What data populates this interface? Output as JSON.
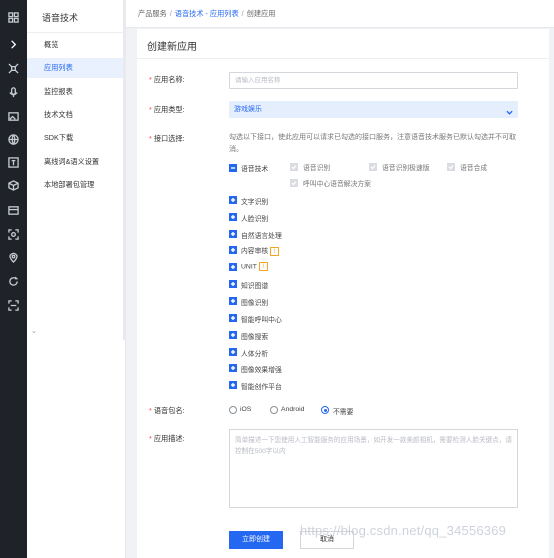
{
  "rail": {
    "icons": [
      "grid-icon",
      "chevron-right-icon",
      "drone-icon",
      "microphone-icon",
      "image-icon",
      "globe-icon",
      "text-icon",
      "cube-icon",
      "screen-icon",
      "face-scan-icon",
      "map-pin-icon",
      "refresh-icon",
      "scan-icon"
    ]
  },
  "menu": {
    "title": "语音技术",
    "items": [
      "概览",
      "应用列表",
      "监控报表",
      "技术文档",
      "SDK下载",
      "离线词&语义设置",
      "本地部署包管理"
    ],
    "active_index": 1,
    "collapse_icon": "chevron-down-icon"
  },
  "breadcrumb": {
    "root": "产品服务",
    "separator": "/",
    "link": "语音技术 - 应用列表",
    "current": "创建应用"
  },
  "page": {
    "title": "创建新应用"
  },
  "form": {
    "required_mark": "*",
    "name": {
      "label": "应用名称:",
      "placeholder": "请输入应用名称",
      "value": ""
    },
    "type": {
      "label": "应用类型:",
      "value": "游戏娱乐"
    },
    "api": {
      "label": "接口选择:",
      "description": "勾选以下接口，使此应用可以请求已勾选的接口服务，注意语音技术服务已默认勾选并不可取消。",
      "speech_group": {
        "label": "语音技术",
        "expanded": true,
        "items": [
          {
            "label": "语音识别",
            "checked": true,
            "disabled": true
          },
          {
            "label": "语音识别极速版",
            "checked": true,
            "disabled": true
          },
          {
            "label": "语音合成",
            "checked": true,
            "disabled": true
          },
          {
            "label": "呼叫中心语音解决方案",
            "checked": true,
            "disabled": true
          }
        ]
      },
      "groups": [
        {
          "label": "文字识别",
          "badge": ""
        },
        {
          "label": "人脸识别",
          "badge": ""
        },
        {
          "label": "自然语言处理",
          "badge": ""
        },
        {
          "label": "内容审核",
          "badge": "!"
        },
        {
          "label": "UNIT",
          "badge": "!"
        },
        {
          "label": "知识图谱",
          "badge": ""
        },
        {
          "label": "图像识别",
          "badge": ""
        },
        {
          "label": "智能呼叫中心",
          "badge": ""
        },
        {
          "label": "图像搜索",
          "badge": ""
        },
        {
          "label": "人体分析",
          "badge": ""
        },
        {
          "label": "图像效果增强",
          "badge": ""
        },
        {
          "label": "智能创作平台",
          "badge": ""
        }
      ]
    },
    "package": {
      "label": "语音包名:",
      "options": [
        "iOS",
        "Android",
        "不需要"
      ],
      "selected": "不需要"
    },
    "description": {
      "label": "应用描述:",
      "placeholder": "简单描述一下您使用人工智能服务的应用场景，如开发一款美颜相机，需要检测人脸关键点，请控制在500字以内"
    },
    "buttons": {
      "submit": "立即创建",
      "cancel": "取消"
    }
  },
  "watermark": "https://blog.csdn.net/qq_34556369",
  "colors": {
    "accent": "#2468f2",
    "required": "#f33e3e",
    "badge": "#f5a623",
    "rail": "#1f2329"
  }
}
